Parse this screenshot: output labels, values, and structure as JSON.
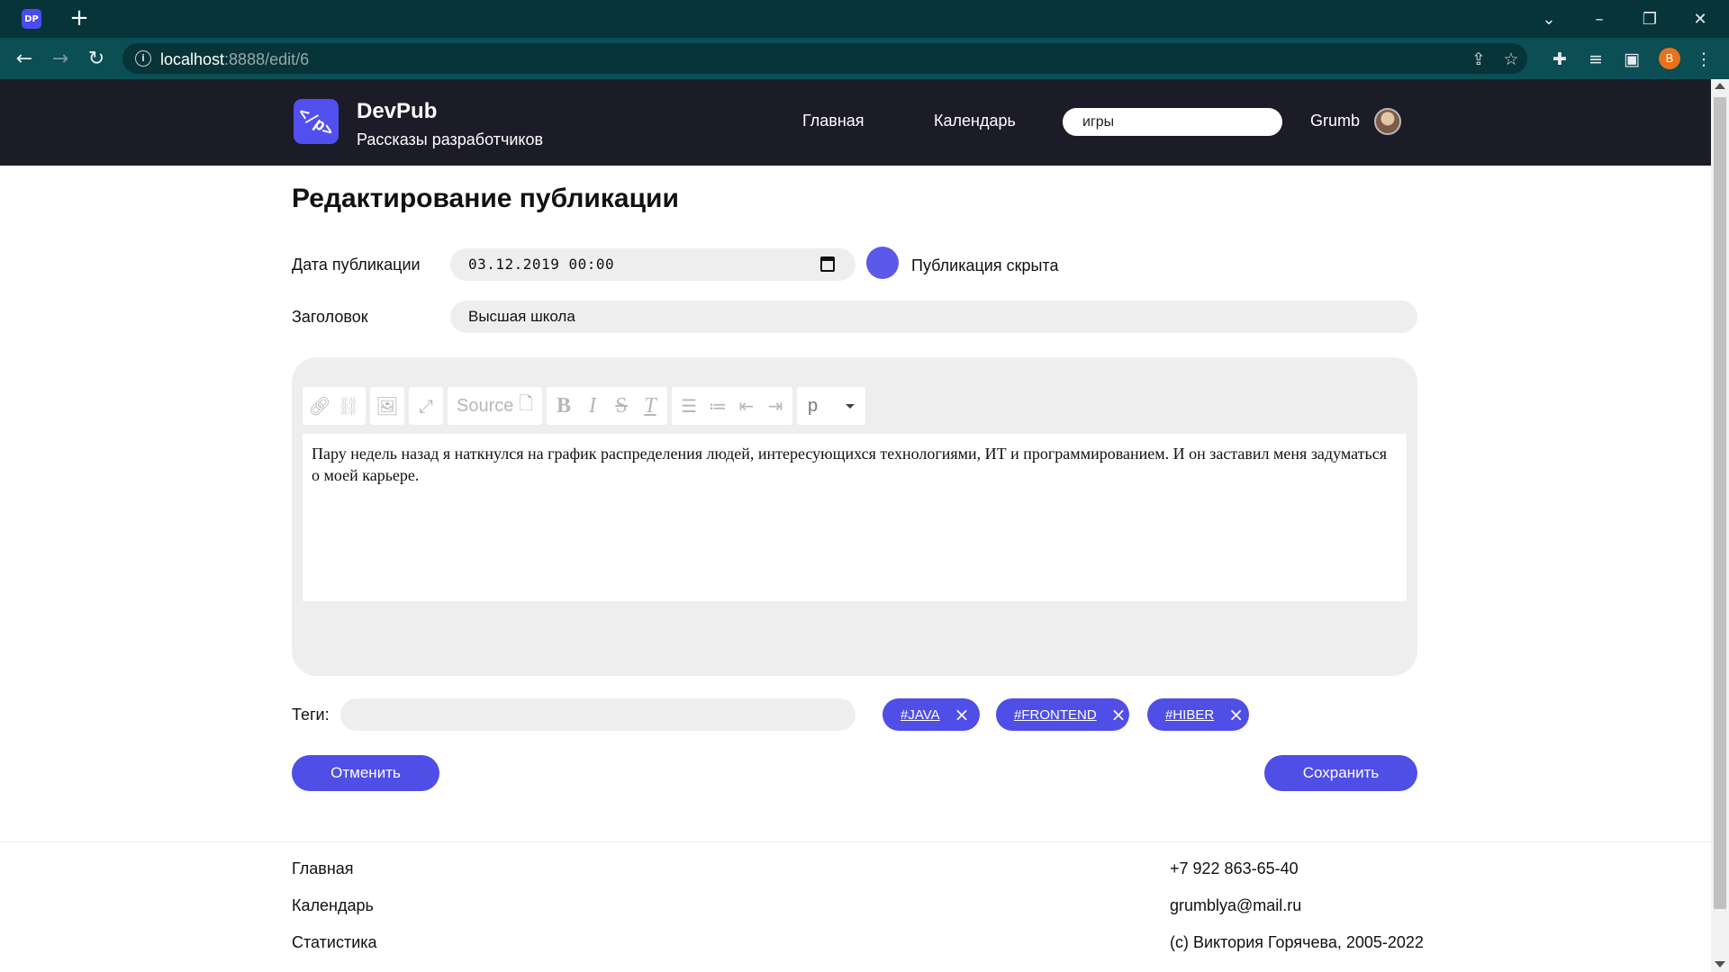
{
  "browser": {
    "favicon_text": "DP",
    "new_tab_icon": "plus-icon",
    "url_host": "localhost",
    "url_path": ":8888/edit/6",
    "profile_initial": "B"
  },
  "header": {
    "logo_text": "</p>",
    "brand": "DevPub",
    "tagline": "Рассказы разработчиков",
    "nav": [
      "Главная",
      "Календарь"
    ],
    "search_value": "игры",
    "username": "Grumb"
  },
  "form": {
    "page_title": "Редактирование публикации",
    "date_label": "Дата публикации",
    "date_value": "03.12.2019 00:00",
    "visibility_label": "Публикация скрыта",
    "title_label": "Заголовок",
    "title_value": "Высшая школа",
    "editor": {
      "toolbar_source": "Source",
      "format_value": "p",
      "body": "Пару недель назад я наткнулся на график распределения людей, интересующихся технологиями, ИТ и программированием. И он заставил меня задуматься о моей карьере."
    },
    "tags_label": "Теги:",
    "tags_input_value": "",
    "tags": [
      "#JAVA",
      "#FRONTEND",
      "#HIBER"
    ],
    "cancel_label": "Отменить",
    "save_label": "Сохранить"
  },
  "footer": {
    "links": [
      "Главная",
      "Календарь",
      "Статистика"
    ],
    "phone": "+7 922 863-65-40",
    "email": "grumblya@mail.ru",
    "copyright": "(с) Виктория Горячева, 2005-2022"
  },
  "colors": {
    "accent": "#4f4ee6",
    "header_bg": "#1c1b28",
    "field_bg": "#eeeeee",
    "chrome_tab": "#063438",
    "chrome_toolbar": "#0b4e53"
  }
}
